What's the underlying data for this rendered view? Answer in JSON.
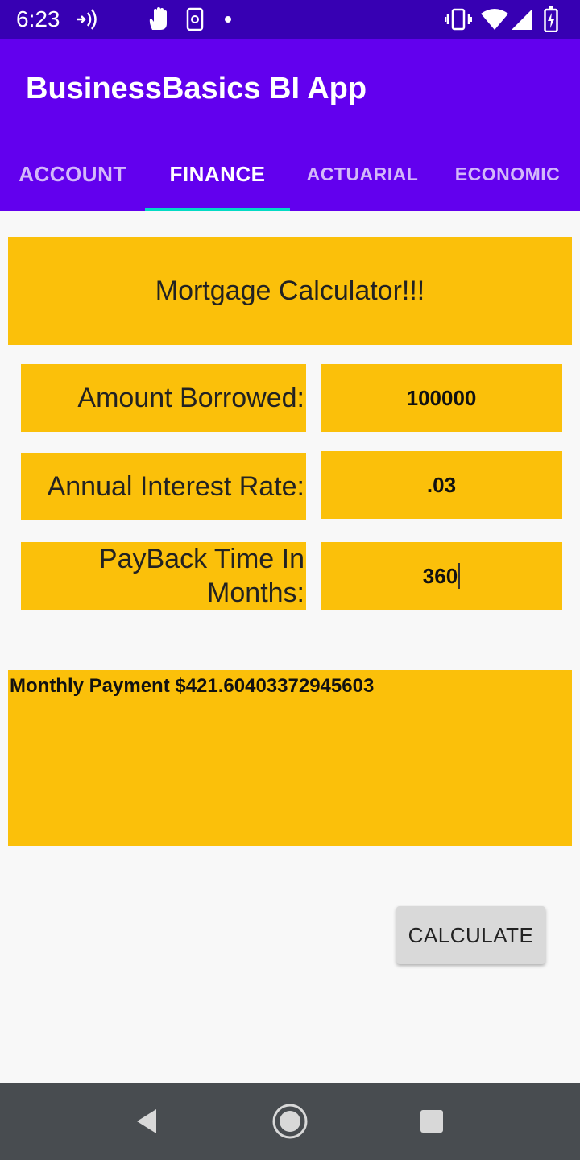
{
  "status_bar": {
    "time": "6:23",
    "icons": [
      "wifi-calling-icon",
      "hand-icon",
      "screen-rotate-icon",
      "dot-icon",
      "vibrate-icon",
      "wifi-icon",
      "signal-icon",
      "battery-charging-icon"
    ]
  },
  "app_bar": {
    "title": "BusinessBasics BI App",
    "tabs": [
      {
        "label": "ACCOUNT",
        "active": false
      },
      {
        "label": "FINANCE",
        "active": true
      },
      {
        "label": "ACTUARIAL",
        "active": false
      },
      {
        "label": "ECONOMIC",
        "active": false
      }
    ]
  },
  "calculator": {
    "title": "Mortgage Calculator!!!",
    "amount_label": "Amount Borrowed:",
    "amount_value": "100000",
    "rate_label": "Annual Interest Rate:",
    "rate_value": ".03",
    "months_label_line1": "PayBack Time In",
    "months_label_line2": "Months:",
    "months_value": "360",
    "result_text": "Monthly Payment $421.60403372945603",
    "button_label": "CALCULATE"
  },
  "colors": {
    "status_bar": "#3700b3",
    "app_bar": "#6200ee",
    "tab_indicator": "#03dac5",
    "panel": "#fbc00a",
    "nav_bar": "#484c50"
  },
  "nav_bar": {
    "icons": [
      "back-icon",
      "home-icon",
      "recents-icon"
    ]
  }
}
